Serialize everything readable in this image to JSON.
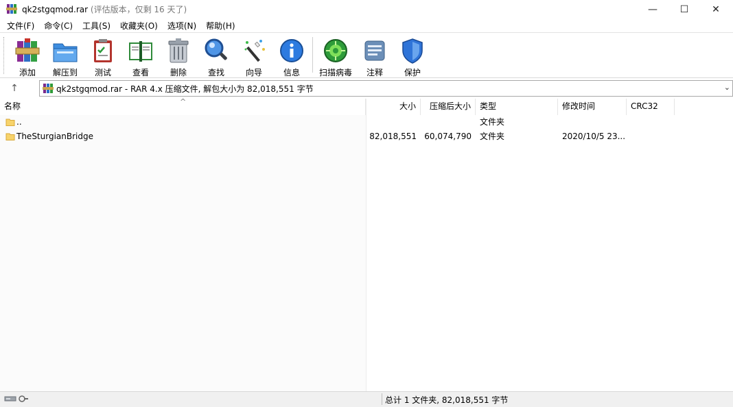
{
  "window": {
    "title": "qk2stgqmod.rar",
    "trial_note": "(评估版本，仅剩 16 天了)",
    "minimize": "—",
    "maximize": "☐",
    "close": "✕"
  },
  "menu": [
    {
      "label": "文件(F)"
    },
    {
      "label": "命令(C)"
    },
    {
      "label": "工具(S)"
    },
    {
      "label": "收藏夹(O)"
    },
    {
      "label": "选项(N)"
    },
    {
      "label": "帮助(H)"
    }
  ],
  "toolbar": [
    {
      "label": "添加",
      "icon": "add-archive-icon"
    },
    {
      "label": "解压到",
      "icon": "extract-folder-icon"
    },
    {
      "label": "测试",
      "icon": "test-clipboard-icon"
    },
    {
      "label": "查看",
      "icon": "view-book-icon"
    },
    {
      "label": "删除",
      "icon": "trash-icon"
    },
    {
      "label": "查找",
      "icon": "magnifier-icon"
    },
    {
      "label": "向导",
      "icon": "wizard-wand-icon"
    },
    {
      "label": "信息",
      "icon": "info-icon"
    },
    {
      "label": "扫描病毒",
      "icon": "virus-scan-icon"
    },
    {
      "label": "注释",
      "icon": "comment-icon"
    },
    {
      "label": "保护",
      "icon": "shield-icon"
    }
  ],
  "address": {
    "up": "↑",
    "text": "qk2stgqmod.rar - RAR 4.x 压缩文件, 解包大小为 82,018,551 字节",
    "dropdown": "⌄"
  },
  "columns": {
    "name": "名称",
    "size": "大小",
    "packed": "压缩后大小",
    "type": "类型",
    "modified": "修改时间",
    "crc": "CRC32",
    "sort_indicator": "^"
  },
  "files": [
    {
      "name": "..",
      "size": "",
      "packed": "",
      "type": "文件夹",
      "modified": "",
      "crc": ""
    },
    {
      "name": "TheSturgianBridge",
      "size": "82,018,551",
      "packed": "60,074,790",
      "type": "文件夹",
      "modified": "2020/10/5 23...",
      "crc": ""
    }
  ],
  "status": {
    "text": "总计 1 文件夹, 82,018,551 字节"
  },
  "colors": {
    "folder": "#f7d36b",
    "accent_blue": "#1f6fd0",
    "status_bg": "#f0f0f0"
  }
}
